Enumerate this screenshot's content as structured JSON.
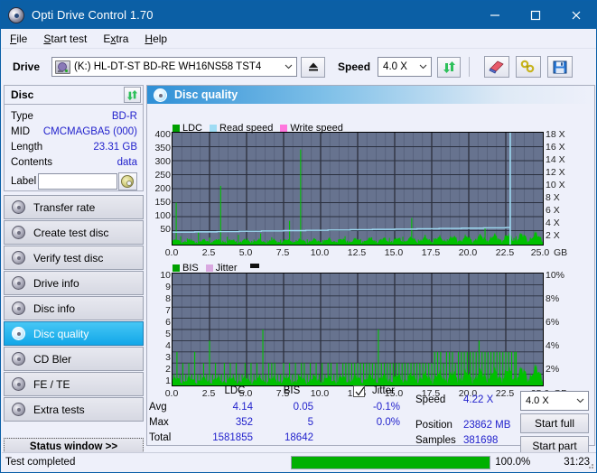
{
  "window": {
    "title": "Opti Drive Control 1.70",
    "icon": "disc-icon",
    "minimize": "minimize-icon",
    "maximize": "maximize-icon",
    "close": "close-icon"
  },
  "menu": {
    "items": [
      {
        "label": "File",
        "accel": "F"
      },
      {
        "label": "Start test",
        "accel": "S"
      },
      {
        "label": "Extra",
        "accel": "x"
      },
      {
        "label": "Help",
        "accel": "H"
      }
    ]
  },
  "toolbar": {
    "drive_label": "Drive",
    "drive_value": "(K:)  HL-DT-ST BD-RE  WH16NS58 TST4",
    "eject_icon": "eject-icon",
    "speed_label": "Speed",
    "speed_value": "4.0 X",
    "refresh_icon": "refresh-icon",
    "erase_icon": "eraser-icon",
    "tools_icon": "tools-icon",
    "save_icon": "save-icon"
  },
  "disc_panel": {
    "title": "Disc",
    "refresh_icon": "refresh-icon",
    "rows": [
      {
        "key": "Type",
        "value": "BD-R"
      },
      {
        "key": "MID",
        "value": "CMCMAGBA5 (000)"
      },
      {
        "key": "Length",
        "value": "23.31 GB"
      },
      {
        "key": "Contents",
        "value": "data"
      }
    ],
    "label_key": "Label",
    "label_value": "",
    "label_placeholder": "",
    "label_button_icon": "cd-icon"
  },
  "sidebar": {
    "items": [
      {
        "label": "Transfer rate",
        "icon": "disc-icon",
        "active": false
      },
      {
        "label": "Create test disc",
        "icon": "disc-icon",
        "active": false
      },
      {
        "label": "Verify test disc",
        "icon": "disc-icon",
        "active": false
      },
      {
        "label": "Drive info",
        "icon": "disc-icon",
        "active": false
      },
      {
        "label": "Disc info",
        "icon": "disc-icon",
        "active": false
      },
      {
        "label": "Disc quality",
        "icon": "disc-icon",
        "active": true
      },
      {
        "label": "CD Bler",
        "icon": "disc-icon",
        "active": false
      },
      {
        "label": "FE / TE",
        "icon": "disc-icon",
        "active": false
      },
      {
        "label": "Extra tests",
        "icon": "disc-icon",
        "active": false
      }
    ],
    "status_window_button": "Status window >>"
  },
  "content": {
    "title": "Disc quality",
    "icon": "disc-icon"
  },
  "chart_data": [
    {
      "type": "line",
      "id": "ldc-chart",
      "title": "",
      "xlabel": "GB",
      "ylabel": "",
      "xlim": [
        0.0,
        25.0
      ],
      "ylim": [
        0,
        400
      ],
      "y2lim": [
        0,
        18
      ],
      "grid": true,
      "legend_position": "top-left",
      "legend": [
        {
          "name": "LDC",
          "color": "#00a000"
        },
        {
          "name": "Read speed",
          "color": "#9fdcf4"
        },
        {
          "name": "Write speed",
          "color": "#ff77dd"
        }
      ],
      "xticks": [
        "0.0",
        "2.5",
        "5.0",
        "7.5",
        "10.0",
        "12.5",
        "15.0",
        "17.5",
        "20.0",
        "22.5",
        "25.0"
      ],
      "yticks": [
        400,
        350,
        300,
        250,
        200,
        150,
        100,
        50
      ],
      "y2ticks": [
        "18 X",
        "16 X",
        "14 X",
        "12 X",
        "10 X",
        "8 X",
        "6 X",
        "4 X",
        "2 X"
      ],
      "series": [
        {
          "name": "LDC",
          "color": "#00c000",
          "kind": "impulse",
          "x": [
            0.1,
            0.25,
            0.4,
            0.55,
            0.7,
            0.85,
            1.0,
            1.15,
            1.3,
            1.45,
            1.6,
            1.75,
            1.9,
            2.05,
            2.2,
            2.35,
            2.5,
            2.65,
            2.8,
            2.95,
            3.1,
            3.25,
            3.4,
            3.55,
            3.7,
            3.85,
            4.0,
            4.15,
            4.3,
            4.45,
            4.6,
            4.75,
            4.9,
            5.05,
            5.2,
            5.35,
            5.5,
            5.65,
            5.8,
            5.95,
            6.1,
            6.25,
            6.4,
            6.55,
            6.7,
            6.85,
            7.0,
            7.15,
            7.3,
            7.45,
            7.6,
            7.75,
            7.9,
            8.05,
            8.2,
            8.35,
            8.5,
            8.65,
            8.8,
            8.95,
            9.1,
            9.25,
            9.4,
            9.55,
            9.7,
            9.85,
            10.0,
            10.15,
            10.3,
            10.45,
            10.6,
            10.75,
            10.9,
            11.05,
            11.2,
            11.35,
            11.5,
            11.65,
            11.8,
            11.95,
            12.1,
            12.25,
            12.4,
            12.55,
            12.7,
            12.85,
            13.0,
            13.15,
            13.3,
            13.45,
            13.6,
            13.75,
            13.9,
            14.05,
            14.2,
            14.35,
            14.5,
            14.65,
            14.8,
            14.95,
            15.1,
            15.25,
            15.4,
            15.55,
            15.7,
            15.85,
            16.0,
            16.15,
            16.3,
            16.45,
            16.6,
            16.75,
            16.9,
            17.05,
            17.2,
            17.35,
            17.5,
            17.65,
            17.8,
            17.95,
            18.1,
            18.25,
            18.4,
            18.55,
            18.7,
            18.85,
            19.0,
            19.15,
            19.3,
            19.45,
            19.6,
            19.75,
            19.9,
            20.05,
            20.2,
            20.35,
            20.5,
            20.65,
            20.8,
            20.95,
            21.1,
            21.25,
            21.4,
            21.55,
            21.7,
            21.85,
            22.0,
            22.15,
            22.3,
            22.45,
            22.6,
            22.75,
            22.9,
            23.05,
            23.2
          ],
          "y": [
            8,
            150,
            12,
            30,
            9,
            14,
            22,
            10,
            18,
            12,
            9,
            45,
            11,
            16,
            10,
            13,
            25,
            9,
            12,
            19,
            10,
            210,
            14,
            11,
            28,
            10,
            16,
            9,
            12,
            35,
            11,
            14,
            10,
            22,
            9,
            13,
            18,
            10,
            12,
            40,
            11,
            9,
            15,
            12,
            26,
            10,
            13,
            9,
            18,
            11,
            14,
            10,
            85,
            12,
            9,
            16,
            11,
            340,
            13,
            10,
            19,
            12,
            9,
            22,
            11,
            14,
            10,
            16,
            12,
            9,
            25,
            11,
            13,
            10,
            18,
            12,
            9,
            30,
            14,
            11,
            9,
            16,
            13,
            10,
            20,
            12,
            9,
            15,
            11,
            26,
            10,
            13,
            9,
            18,
            12,
            11,
            9,
            24,
            13,
            10,
            16,
            12,
            9,
            28,
            11,
            14,
            10,
            95,
            13,
            9,
            18,
            12,
            11,
            35,
            10,
            14,
            9,
            22,
            12,
            10,
            16,
            13,
            9,
            19,
            11,
            14,
            10,
            25,
            12,
            9,
            17,
            13,
            11,
            20,
            10,
            14,
            9,
            30,
            12,
            11,
            60,
            14,
            10,
            18,
            13,
            9,
            22,
            12,
            14,
            26,
            16,
            13,
            19,
            24,
            30,
            22,
            28
          ]
        },
        {
          "name": "Read speed",
          "color": "#9fdcf4",
          "kind": "step-line",
          "axis": "right",
          "x": [
            0.0,
            1.5,
            3.0,
            4.5,
            6.0,
            7.5,
            9.0,
            10.5,
            12.0,
            13.5,
            15.0,
            16.5,
            18.0,
            19.5,
            21.0,
            22.5,
            22.8
          ],
          "y": [
            2.0,
            2.05,
            2.1,
            2.15,
            2.2,
            2.25,
            2.3,
            2.35,
            2.4,
            2.45,
            2.5,
            2.55,
            2.6,
            2.65,
            2.7,
            2.75,
            18.0
          ]
        }
      ],
      "stats_hint": "LDC avg 4.14, max 352, total 1581855"
    },
    {
      "type": "line",
      "id": "bis-chart",
      "title": "",
      "xlabel": "GB",
      "ylabel": "",
      "xlim": [
        0.0,
        25.0
      ],
      "ylim": [
        0,
        10
      ],
      "y2lim": [
        0,
        10
      ],
      "grid": true,
      "legend_position": "top-left",
      "legend": [
        {
          "name": "BIS",
          "color": "#00a000"
        },
        {
          "name": "Jitter",
          "color": "#d9a8e0"
        }
      ],
      "xticks": [
        "0.0",
        "2.5",
        "5.0",
        "7.5",
        "10.0",
        "12.5",
        "15.0",
        "17.5",
        "20.0",
        "22.5",
        "25.0"
      ],
      "yticks": [
        10,
        9,
        8,
        7,
        6,
        5,
        4,
        3,
        2,
        1
      ],
      "y2ticks": [
        "10%",
        "8%",
        "6%",
        "4%",
        "2%"
      ],
      "series": [
        {
          "name": "BIS",
          "color": "#00c000",
          "kind": "impulse",
          "x": [
            0.1,
            0.3,
            0.5,
            0.7,
            0.9,
            1.1,
            1.3,
            1.5,
            1.7,
            1.9,
            2.1,
            2.3,
            2.5,
            2.7,
            2.9,
            3.1,
            3.3,
            3.5,
            3.7,
            3.9,
            4.1,
            4.3,
            4.5,
            4.7,
            4.9,
            5.1,
            5.3,
            5.5,
            5.7,
            5.9,
            6.1,
            6.3,
            6.5,
            6.7,
            6.9,
            7.1,
            7.3,
            7.5,
            7.7,
            7.9,
            8.1,
            8.3,
            8.5,
            8.7,
            8.9,
            9.1,
            9.3,
            9.5,
            9.7,
            9.9,
            10.1,
            10.3,
            10.5,
            10.7,
            10.9,
            11.1,
            11.3,
            11.5,
            11.7,
            11.9,
            12.1,
            12.3,
            12.5,
            12.7,
            12.9,
            13.1,
            13.3,
            13.5,
            13.7,
            13.9,
            14.1,
            14.3,
            14.5,
            14.7,
            14.9,
            15.1,
            15.3,
            15.5,
            15.7,
            15.9,
            16.1,
            16.3,
            16.5,
            16.7,
            16.9,
            17.1,
            17.3,
            17.5,
            17.7,
            17.9,
            18.1,
            18.3,
            18.5,
            18.7,
            18.9,
            19.1,
            19.3,
            19.5,
            19.7,
            19.9,
            20.1,
            20.3,
            20.5,
            20.7,
            20.9,
            21.1,
            21.3,
            21.5,
            21.7,
            21.9,
            22.1,
            22.3,
            22.5,
            22.7,
            22.9,
            23.1,
            23.2
          ],
          "y": [
            1,
            3,
            1,
            2,
            1,
            2,
            1,
            3,
            1,
            1,
            2,
            1,
            4,
            1,
            2,
            1,
            1,
            2,
            1,
            2,
            1,
            2,
            1,
            1,
            2,
            1,
            2,
            1,
            2,
            1,
            5,
            1,
            2,
            2,
            2,
            1,
            1,
            2,
            1,
            2,
            1,
            2,
            1,
            2,
            2,
            1,
            2,
            1,
            2,
            1,
            2,
            1,
            2,
            2,
            1,
            2,
            1,
            2,
            2,
            2,
            2,
            2,
            2,
            2,
            2,
            2,
            2,
            2,
            2,
            5,
            2,
            2,
            2,
            2,
            2,
            2,
            2,
            2,
            2,
            2,
            2,
            2,
            2,
            2,
            2,
            2,
            2,
            2,
            3,
            3,
            3,
            2,
            3,
            3,
            3,
            2,
            3,
            3,
            3,
            3,
            3,
            3,
            3,
            4,
            3,
            3,
            3,
            3,
            3,
            3,
            3,
            3,
            3,
            3,
            3,
            3,
            3
          ]
        },
        {
          "name": "Jitter",
          "color": "#d9a8e0",
          "kind": "line",
          "axis": "right",
          "x": [],
          "y": []
        }
      ],
      "stats_hint": "BIS avg 0.05, max 5, total 18642"
    }
  ],
  "stats": {
    "col_headers": [
      "LDC",
      "BIS"
    ],
    "row_labels": [
      "Avg",
      "Max",
      "Total"
    ],
    "ldc": {
      "avg": "4.14",
      "max": "352",
      "total": "1581855"
    },
    "bis": {
      "avg": "0.05",
      "max": "5",
      "total": "18642"
    },
    "jitter": {
      "checkbox_label": "Jitter",
      "checked": true,
      "avg": "-0.1%",
      "max": "0.0%"
    }
  },
  "readout": {
    "speed_label": "Speed",
    "speed_value": "4.22 X",
    "position_label": "Position",
    "position_value": "23862 MB",
    "samples_label": "Samples",
    "samples_value": "381698",
    "speed_select": "4.0 X",
    "start_full_button": "Start full",
    "start_part_button": "Start part"
  },
  "statusbar": {
    "message": "Test completed",
    "progress_percent": "100.0%",
    "progress_value": 100,
    "elapsed": "31:23"
  },
  "colors": {
    "titlebar": "#0b5fa5",
    "accent": "#12a7e8",
    "plot_bg": "#67738f",
    "ldc_green": "#00c000",
    "read_speed": "#9fdcf4",
    "write_speed": "#ff77dd",
    "jitter": "#d9a8e0",
    "value_text": "#2222cc",
    "progress": "#00b000"
  }
}
